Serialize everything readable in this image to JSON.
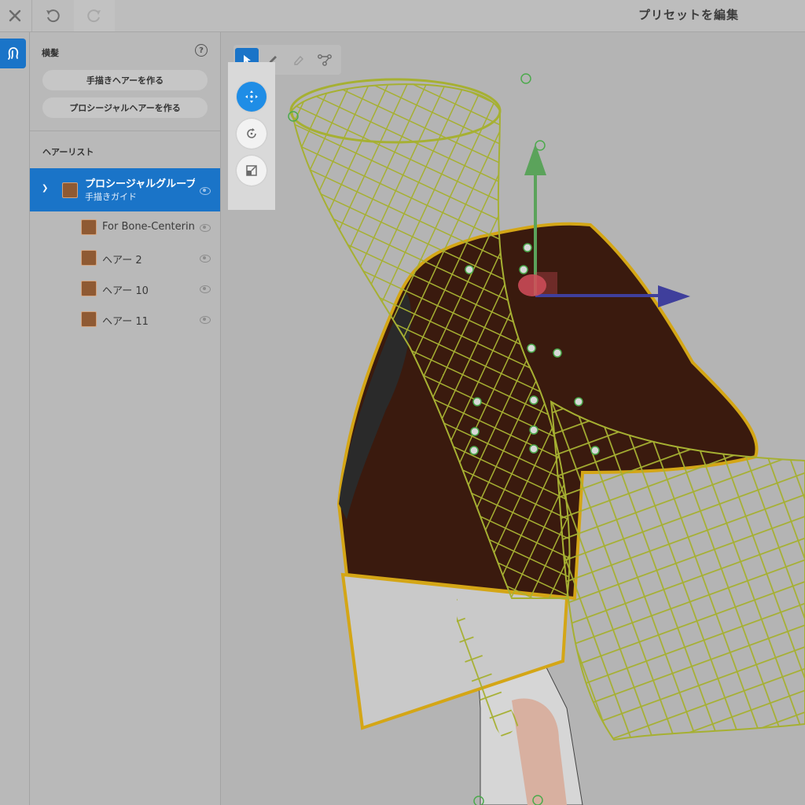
{
  "header": {
    "title": "プリセットを編集"
  },
  "toolbar": {
    "close_icon": "close-icon",
    "undo_icon": "undo-icon",
    "redo_icon": "redo-icon"
  },
  "rail": {
    "active_icon": "hair-icon",
    "accent": "#1a74c8"
  },
  "panel": {
    "section_title": "横髪",
    "create_hand_drawn": "手描きヘアーを作る",
    "create_procedural": "プロシージャルヘアーを作る",
    "list_title": "ヘアーリスト",
    "group": {
      "name": "プロシージャルグループ",
      "sub": "手描きガイド",
      "color": "#8f5a33"
    },
    "items": [
      {
        "name": "For Bone-Centering",
        "color": "#8f5a33"
      },
      {
        "name": "ヘアー 2",
        "color": "#8f5a33"
      },
      {
        "name": "ヘアー 10",
        "color": "#8f5a33"
      },
      {
        "name": "ヘアー 11",
        "color": "#8f5a33"
      }
    ]
  },
  "viewport": {
    "tools": [
      "select-arrow-icon",
      "pen-icon",
      "eraser-icon",
      "path-node-icon"
    ],
    "transform_modes": [
      "move-icon",
      "rotate-icon",
      "scale-icon"
    ],
    "gizmo_colors": {
      "y_axis": "#5ba35b",
      "x_axis": "#3f3f9c",
      "center": "#d24d5a"
    },
    "hair_color": "#3a1a0e",
    "mesh_color": "#a6b032",
    "outline_color": "#d4a616"
  }
}
